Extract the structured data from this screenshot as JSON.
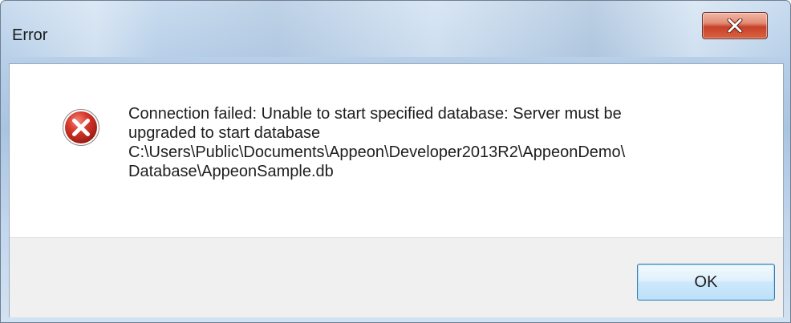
{
  "window": {
    "title": "Error"
  },
  "titlebar": {
    "close_icon": "close-x-icon"
  },
  "dialog": {
    "icon": "error-icon",
    "message": "Connection failed: Unable to start specified database: Server must be\nupgraded to start database\nC:\\Users\\Public\\Documents\\Appeon\\Developer2013R2\\AppeonDemo\\\nDatabase\\AppeonSample.db",
    "ok_label": "OK"
  },
  "colors": {
    "close_button": "#c7412a",
    "error_icon": "#c62828",
    "ok_button_border": "#3c7fb1",
    "footer_background": "#f0f0f0"
  }
}
